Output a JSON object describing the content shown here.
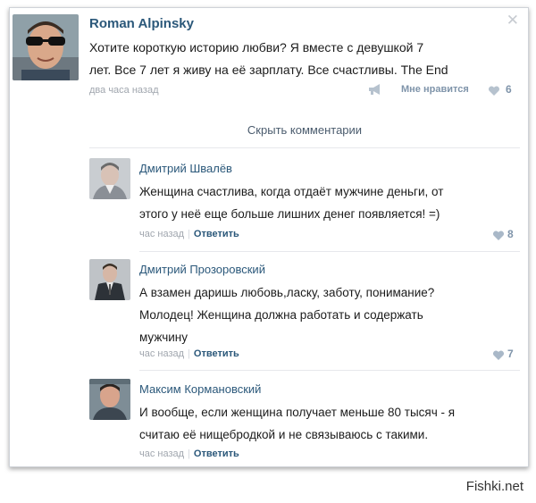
{
  "post": {
    "author": "Roman Alpinsky",
    "text_line1": "Хотите короткую историю любви? Я вместе с девушкой 7",
    "text_line2": "лет. Все 7 лет я живу на её зарплату. Все счастливы. The End",
    "time": "два часа назад",
    "like_label": "Мне нравится",
    "like_count": "6",
    "close_symbol": "✕"
  },
  "hide_comments_label": "Скрыть комментарии",
  "comments": [
    {
      "author": "Дмитрий Швалёв",
      "line1": "Женщина счастлива, когда отдаёт мужчине деньги, от",
      "line2": "этого у неё еще больше лишних денег появляется! =)",
      "line3": "",
      "time": "час назад",
      "reply": "Ответить",
      "likes": "8"
    },
    {
      "author": "Дмитрий Прозоровский",
      "line1": "А взамен даришь любовь,ласку, заботу, понимание?",
      "line2": "Молодец! Женщина должна работать и содержать",
      "line3": "мужчину",
      "time": "час назад",
      "reply": "Ответить",
      "likes": "7"
    },
    {
      "author": "Максим Кормановский",
      "line1": "И вообще, если женщина получает меньше 80 тысяч - я",
      "line2": "считаю её нищебродкой и не связываюсь с такими.",
      "line3": "",
      "time": "час назад",
      "reply": "Ответить",
      "likes": ""
    }
  ],
  "watermark": "Fishki.net",
  "colors": {
    "name_link": "#2b587a",
    "meta_gray": "#a0a6ae",
    "like_blue": "#7f94aa"
  }
}
